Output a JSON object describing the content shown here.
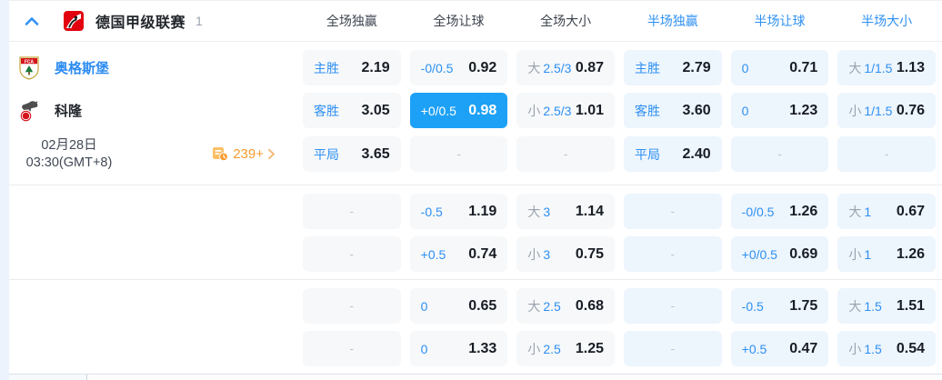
{
  "league": {
    "name": "德国甲级联赛",
    "match_count": "1"
  },
  "columns": [
    {
      "label": "全场独赢"
    },
    {
      "label": "全场让球"
    },
    {
      "label": "全场大小"
    },
    {
      "label": "半场独赢"
    },
    {
      "label": "半场让球"
    },
    {
      "label": "半场大小"
    }
  ],
  "match": {
    "home_team": "奥格斯堡",
    "away_team": "科隆",
    "date": "02月28日",
    "time": "03:30(GMT+8)",
    "more_markets_count": "239+"
  },
  "colors": {
    "accent_blue": "#2e90f3",
    "highlight_cell": "#1da1f6",
    "halftime_cell_bg": "#edf5fd",
    "fulltime_cell_bg": "#f6f8fa",
    "orange": "#f79b30"
  },
  "odds": {
    "rows": [
      {
        "cells": [
          {
            "label": "主胜",
            "value": "2.19"
          },
          {
            "label": "-0/0.5",
            "value": "0.92"
          },
          {
            "prefix": "大",
            "label": "2.5/3",
            "value": "0.87"
          },
          {
            "label": "主胜",
            "value": "2.79"
          },
          {
            "label": "0",
            "value": "0.71"
          },
          {
            "prefix": "大",
            "label": "1/1.5",
            "value": "1.13"
          }
        ]
      },
      {
        "cells": [
          {
            "label": "客胜",
            "value": "3.05"
          },
          {
            "label": "+0/0.5",
            "value": "0.98"
          },
          {
            "prefix": "小",
            "label": "2.5/3",
            "value": "1.01"
          },
          {
            "label": "客胜",
            "value": "3.60"
          },
          {
            "label": "0",
            "value": "1.23"
          },
          {
            "prefix": "小",
            "label": "1/1.5",
            "value": "0.76"
          }
        ]
      },
      {
        "cells": [
          {
            "label": "平局",
            "value": "3.65"
          },
          {
            "dash": "-"
          },
          {
            "dash": "-"
          },
          {
            "label": "平局",
            "value": "2.40"
          },
          {
            "dash": "-"
          },
          {
            "dash": "-"
          }
        ]
      },
      {
        "cells": [
          {
            "dash": "-"
          },
          {
            "label": "-0.5",
            "value": "1.19"
          },
          {
            "prefix": "大",
            "label": "3",
            "value": "1.14"
          },
          {
            "dash": "-"
          },
          {
            "label": "-0/0.5",
            "value": "1.26"
          },
          {
            "prefix": "大",
            "label": "1",
            "value": "0.67"
          }
        ]
      },
      {
        "cells": [
          {
            "dash": "-"
          },
          {
            "label": "+0.5",
            "value": "0.74"
          },
          {
            "prefix": "小",
            "label": "3",
            "value": "0.75"
          },
          {
            "dash": "-"
          },
          {
            "label": "+0/0.5",
            "value": "0.69"
          },
          {
            "prefix": "小",
            "label": "1",
            "value": "1.26"
          }
        ]
      },
      {
        "cells": [
          {
            "dash": "-"
          },
          {
            "label": "0",
            "value": "0.65"
          },
          {
            "prefix": "大",
            "label": "2.5",
            "value": "0.68"
          },
          {
            "dash": "-"
          },
          {
            "label": "-0.5",
            "value": "1.75"
          },
          {
            "prefix": "大",
            "label": "1.5",
            "value": "1.51"
          }
        ]
      },
      {
        "cells": [
          {
            "dash": "-"
          },
          {
            "label": "0",
            "value": "1.33"
          },
          {
            "prefix": "小",
            "label": "2.5",
            "value": "1.25"
          },
          {
            "dash": "-"
          },
          {
            "label": "+0.5",
            "value": "0.47"
          },
          {
            "prefix": "小",
            "label": "1.5",
            "value": "0.54"
          }
        ]
      }
    ]
  }
}
